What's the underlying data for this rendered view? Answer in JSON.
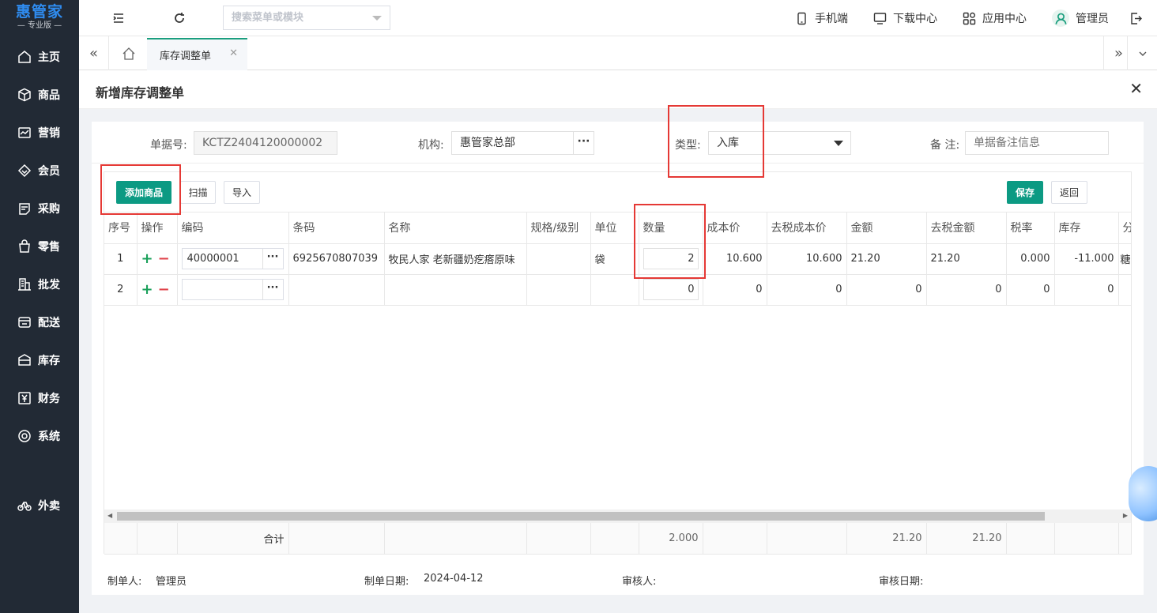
{
  "sidebar": {
    "logo_main": "惠管家",
    "logo_sub": "— 专业版 —",
    "items": [
      {
        "label": "主页",
        "icon": "home-icon"
      },
      {
        "label": "商品",
        "icon": "cube-icon"
      },
      {
        "label": "营销",
        "icon": "trend-chart-icon"
      },
      {
        "label": "会员",
        "icon": "diamond-icon"
      },
      {
        "label": "采购",
        "icon": "clipboard-icon"
      },
      {
        "label": "零售",
        "icon": "shopping-bag-icon"
      },
      {
        "label": "批发",
        "icon": "building-icon"
      },
      {
        "label": "配送",
        "icon": "delivery-icon"
      },
      {
        "label": "库存",
        "icon": "warehouse-icon"
      },
      {
        "label": "财务",
        "icon": "yen-icon"
      },
      {
        "label": "系统",
        "icon": "settings-icon"
      },
      {
        "label": "外卖",
        "icon": "bike-icon"
      }
    ]
  },
  "topbar": {
    "search_placeholder": "搜索菜单或模块",
    "mobile": "手机端",
    "download": "下载中心",
    "apps": "应用中心",
    "user": "管理员"
  },
  "tabs": {
    "active": "库存调整单"
  },
  "page": {
    "title": "新增库存调整单"
  },
  "form": {
    "doc_no_label": "单据号:",
    "doc_no": "KCTZ2404120000002",
    "org_label": "机构:",
    "org": "惠管家总部",
    "type_label": "类型:",
    "type": "入库",
    "remark_label": "备 注:",
    "remark_placeholder": "单据备注信息"
  },
  "toolbar": {
    "add_product": "添加商品",
    "scan": "扫描",
    "import": "导入",
    "save": "保存",
    "back": "返回"
  },
  "table": {
    "headers": [
      "序号",
      "操作",
      "编码",
      "条码",
      "名称",
      "规格/级别",
      "单位",
      "数量",
      "成本价",
      "去税成本价",
      "金额",
      "去税金额",
      "税率",
      "库存",
      "分"
    ],
    "rows": [
      {
        "seq": "1",
        "code": "40000001",
        "barcode": "6925670807039",
        "name": "牧民人家 老新疆奶疙瘩原味",
        "spec": "",
        "unit": "袋",
        "qty": "2",
        "cost": "10.600",
        "cost_ex": "10.600",
        "amount": "21.20",
        "amount_ex": "21.20",
        "tax": "0.000",
        "stock": "-11.000",
        "cat": "糖"
      },
      {
        "seq": "2",
        "code": "",
        "barcode": "",
        "name": "",
        "spec": "",
        "unit": "",
        "qty": "0",
        "cost": "0",
        "cost_ex": "0",
        "amount": "0",
        "amount_ex": "0",
        "tax": "0",
        "stock": "0",
        "cat": ""
      }
    ],
    "total_label": "合计",
    "total_qty": "2.000",
    "total_amount": "21.20",
    "total_amount_ex": "21.20"
  },
  "footer": {
    "maker_label": "制单人:",
    "maker": "管理员",
    "date_label": "制单日期:",
    "date": "2024-04-12",
    "auditor_label": "审核人:",
    "audit_date_label": "审核日期:"
  },
  "colors": {
    "sidebar_bg": "#222a35",
    "primary": "#0c9a83",
    "highlight": "#e53935"
  }
}
